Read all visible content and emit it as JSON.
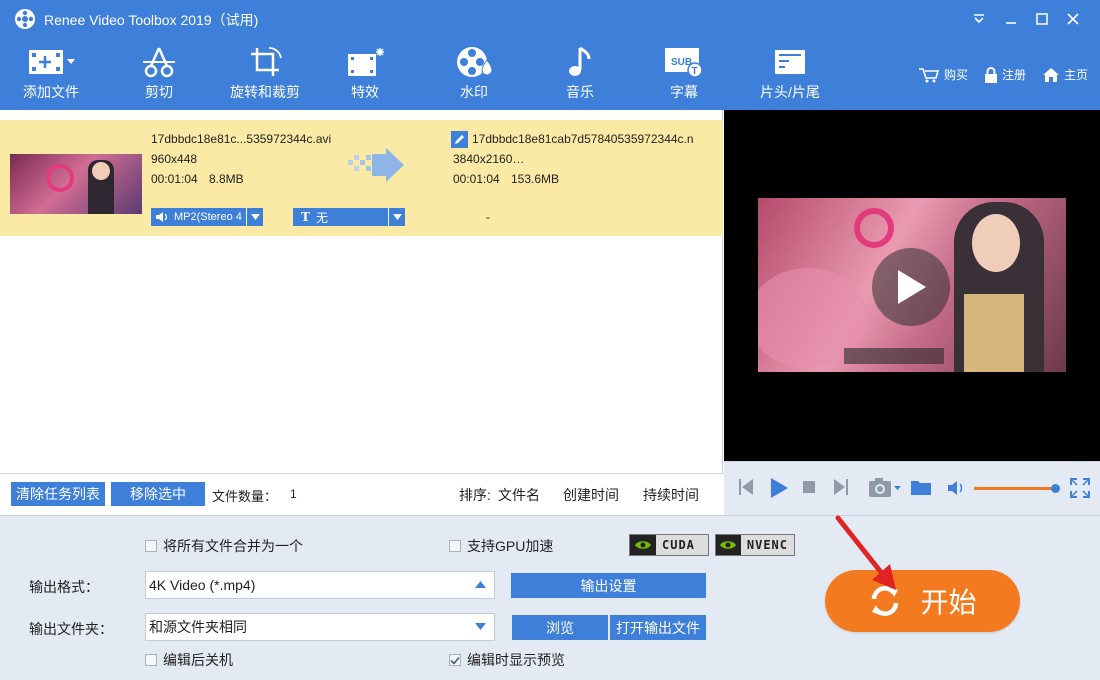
{
  "window": {
    "title": "Renee Video Toolbox 2019（试用)"
  },
  "toolbar": {
    "tools": [
      {
        "label": "添加文件",
        "icon": "add-file-icon"
      },
      {
        "label": "剪切",
        "icon": "cut-icon"
      },
      {
        "label": "旋转和裁剪",
        "icon": "rotate-crop-icon"
      },
      {
        "label": "特效",
        "icon": "effects-icon"
      },
      {
        "label": "水印",
        "icon": "watermark-icon"
      },
      {
        "label": "音乐",
        "icon": "music-icon"
      },
      {
        "label": "字幕",
        "icon": "subtitle-icon"
      },
      {
        "label": "片头/片尾",
        "icon": "intro-outro-icon"
      }
    ],
    "buy": "购买",
    "register": "注册",
    "home": "主页"
  },
  "file": {
    "src_name": "17dbbdc18e81c...535972344c.avi",
    "src_res": "960x448",
    "src_duration": "00:01:04",
    "src_size": "8.8MB",
    "dst_name": "17dbbdc18e81cab7d57840535972344c.n",
    "dst_res": "3840x2160…",
    "dst_duration": "00:01:04",
    "dst_size": "153.6MB",
    "audio_track": "MP2(Stereo 4",
    "subtitle": "无",
    "dash": "-"
  },
  "listbar": {
    "clear": "清除任务列表",
    "remove": "移除选中",
    "count_label": "文件数量：",
    "count": "1",
    "sort_label": "排序:",
    "sort_name": "文件名",
    "sort_created": "创建时间",
    "sort_duration": "持续时间"
  },
  "settings": {
    "merge": "将所有文件合并为一个",
    "gpu": "支持GPU加速",
    "cuda": "CUDA",
    "nvenc": "NVENC",
    "format_label": "输出格式：",
    "format_value": "4K Video (*.mp4)",
    "output_settings": "输出设置",
    "folder_label": "输出文件夹：",
    "folder_value": "和源文件夹相同",
    "browse": "浏览",
    "open_folder": "打开输出文件",
    "shutdown": "编辑后关机",
    "show_preview": "编辑时显示预览",
    "merge_checked": false,
    "gpu_checked": false,
    "shutdown_checked": false,
    "show_preview_checked": true,
    "start": "开始"
  },
  "colors": {
    "brand_blue": "#3d7fd9",
    "row_highlight": "#fbeaa6",
    "start_orange": "#f37a1f",
    "panel_bg": "#e4eaf3"
  }
}
